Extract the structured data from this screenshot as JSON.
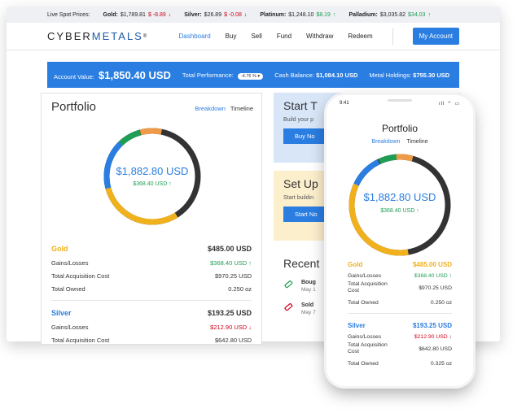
{
  "ticker": {
    "label": "Live Spot Prices:",
    "items": [
      {
        "name": "Gold:",
        "price": "$1,789.81",
        "change": "$ -8.89",
        "dir": "↓",
        "trend": "neg"
      },
      {
        "name": "Silver:",
        "price": "$26.89",
        "change": "$ -0.08",
        "dir": "↓",
        "trend": "neg"
      },
      {
        "name": "Platinum:",
        "price": "$1,248.10",
        "change": "$8.19",
        "dir": "↑",
        "trend": "pos"
      },
      {
        "name": "Palladium:",
        "price": "$3,035.82",
        "change": "$34.03",
        "dir": "↑",
        "trend": "pos"
      }
    ]
  },
  "brand": {
    "cyber": "CYBER",
    "metals": "METALS",
    "reg": "®"
  },
  "nav": {
    "links": [
      "Dashboard",
      "Buy",
      "Sell",
      "Fund",
      "Withdraw",
      "Redeem"
    ],
    "account_button": "My Account"
  },
  "banner": {
    "account_value_label": "Account Value:",
    "account_value": "$1,850.40 USD",
    "performance_label": "Total Performance:",
    "performance_pill": "-4.76 % ▾",
    "cash_label": "Cash Balance:",
    "cash_value": "$1,084.10 USD",
    "holdings_label": "Metal Holdings:",
    "holdings_value": "$755.30 USD"
  },
  "portfolio": {
    "title": "Portfolio",
    "tab_breakdown": "Breakdown",
    "tab_timeline": "Timeline",
    "total": "$1,882.80 USD",
    "gain": "$368.40 USD ↑",
    "gold": {
      "name": "Gold",
      "value": "$485.00 USD",
      "gains_label": "Gains/Losses",
      "gains": "$368.40 USD ↑",
      "cost_label": "Total Acquisition Cost",
      "cost": "$970.25 USD",
      "owned_label": "Total Owned",
      "owned": "0.250 oz"
    },
    "silver": {
      "name": "Silver",
      "value": "$193.25 USD",
      "gains_label": "Gains/Losses",
      "gains": "$212.90 USD ↓",
      "cost_label": "Total Acquisition Cost",
      "cost": "$642.80 USD"
    }
  },
  "cards": {
    "start_title": "Start T",
    "start_text": "Build your p",
    "start_button": "Buy No",
    "setup_title": "Set Up",
    "setup_text": "Start buildin",
    "setup_button": "Start No"
  },
  "recent": {
    "title": "Recent",
    "items": [
      {
        "title": "Boug",
        "sub": "May 1"
      },
      {
        "title": "Sold",
        "sub": "May 7"
      }
    ]
  },
  "phone": {
    "time": "9:41",
    "signal": "ıll ⌔ ▭",
    "title": "Portfolio",
    "tab_breakdown": "Breakdown",
    "tab_timeline": "Timeline",
    "total": "$1,882.80 USD",
    "gain": "$368.40 USD ↑",
    "gold": {
      "name": "Gold",
      "value": "$485.00 USD",
      "gains_label": "Gains/Losses",
      "gains": "$368.40 USD ↑",
      "cost_label": "Total Acquisition Cost",
      "cost": "$970.25 USD",
      "owned_label": "Total Owned",
      "owned": "0.250 oz"
    },
    "silver": {
      "name": "Silver",
      "value": "$193.25 USD",
      "gains_label": "Gains/Losses",
      "gains": "$212.90 USD ↓",
      "cost_label": "Total Acquisition Cost",
      "cost": "$642.80 USD",
      "owned_label": "Total Owned",
      "owned": "0.325 oz"
    }
  },
  "colors": {
    "accent": "#2a7de1",
    "gold": "#f0b11d",
    "green": "#1f9d55",
    "red": "#d0021b",
    "orange": "#ee9a48",
    "dark": "#333333"
  }
}
